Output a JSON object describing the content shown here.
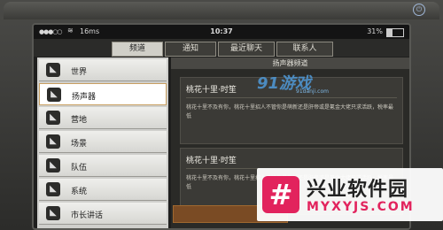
{
  "status_bar": {
    "signal": "●●●○○",
    "network": "16ms",
    "time": "10:37",
    "battery": "31%",
    "battery_level": 0.31
  },
  "tabs": [
    {
      "label": "频道",
      "active": true
    },
    {
      "label": "通知",
      "active": false
    },
    {
      "label": "最近聊天",
      "active": false
    },
    {
      "label": "联系人",
      "active": false
    }
  ],
  "sidebar": {
    "items": [
      {
        "label": "世界",
        "icon": "megaphone-icon"
      },
      {
        "label": "扬声器",
        "icon": "megaphone-icon",
        "active": true
      },
      {
        "label": "营地",
        "icon": "megaphone-icon"
      },
      {
        "label": "场景",
        "icon": "megaphone-icon"
      },
      {
        "label": "队伍",
        "icon": "megaphone-icon"
      },
      {
        "label": "系统",
        "icon": "megaphone-icon"
      },
      {
        "label": "市长讲话",
        "icon": "megaphone-icon"
      }
    ]
  },
  "channel": {
    "title": "扬声器频道",
    "messages": [
      {
        "name": "桃花十里·时笙",
        "text": "桃花十里不及有你，桃花十里招人不管你是萌新还是肝帝或是氪金大佬只求活跃，税率最低"
      },
      {
        "name": "桃花十里·时笙",
        "text": "桃花十里不及有你，桃花十里招人不管你是萌新还是肝帝或是氪金大佬只求活跃，税率最低"
      }
    ]
  },
  "watermarks": {
    "top_brand": "91游戏",
    "top_url": "91danji.com",
    "bottom_logo": "#",
    "bottom_name": "兴业软件园",
    "bottom_url": "MYXYJS.COM"
  }
}
